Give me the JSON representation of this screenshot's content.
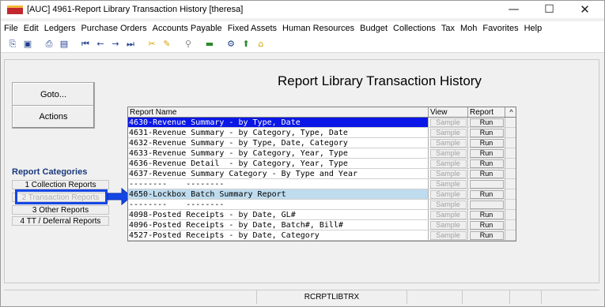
{
  "window": {
    "title": "[AUC] 4961-Report Library Transaction History [theresa]",
    "min_glyph": "—",
    "max_glyph": "☐",
    "close_glyph": "✕"
  },
  "menu": [
    "File",
    "Edit",
    "Ledgers",
    "Purchase Orders",
    "Accounts Payable",
    "Fixed Assets",
    "Human Resources",
    "Budget",
    "Collections",
    "Tax",
    "Moh",
    "Favorites",
    "Help"
  ],
  "toolbar": [
    "copy-icon",
    "paste-icon",
    "print-icon",
    "print-preview-icon",
    "first-record-icon",
    "previous-record-icon",
    "next-record-icon",
    "last-record-icon",
    "tools-icon",
    "tools2-icon",
    "find-icon",
    "view-icon",
    "settings-icon",
    "export-icon",
    "import-icon"
  ],
  "page": {
    "title": "Report Library Transaction History",
    "goto_label": "Goto...",
    "actions_label": "Actions"
  },
  "categories": {
    "title": "Report Categories",
    "items": [
      "1 Collection Reports",
      "2 Transaction Reports",
      "3 Other Reports",
      "4 TT / Deferral Reports"
    ]
  },
  "grid": {
    "headers": {
      "name": "Report Name",
      "view": "View",
      "report": "Report"
    },
    "sample_label": "Sample",
    "run_label": "Run",
    "rows": [
      {
        "name": "4630-Revenue Summary - by Type, Date",
        "run": true,
        "state": "selected"
      },
      {
        "name": "4631-Revenue Summary - by Category, Type, Date",
        "run": true,
        "state": ""
      },
      {
        "name": "4632-Revenue Summary - by Type, Date, Category",
        "run": true,
        "state": ""
      },
      {
        "name": "4633-Revenue Summary - by Category, Year, Type",
        "run": true,
        "state": ""
      },
      {
        "name": "4636-Revenue Detail  - by Category, Year, Type",
        "run": true,
        "state": ""
      },
      {
        "name": "4637-Revenue Summary Category - By Type and Year",
        "run": true,
        "state": ""
      },
      {
        "name": "--------    --------",
        "run": false,
        "state": ""
      },
      {
        "name": "4650-Lockbox Batch Summary Report",
        "run": true,
        "state": "lightsel"
      },
      {
        "name": "--------    --------",
        "run": false,
        "state": ""
      },
      {
        "name": "4098-Posted Receipts - by Date, GL#",
        "run": true,
        "state": ""
      },
      {
        "name": "4096-Posted Receipts - by Date, Batch#, Bill#",
        "run": true,
        "state": ""
      },
      {
        "name": "4527-Posted Receipts - by Date, Category",
        "run": true,
        "state": ""
      }
    ]
  },
  "status": {
    "program": "RCRPTLIBTRX"
  },
  "colors": {
    "selected_row": "#0a17e6",
    "highlight_box": "#1446e6",
    "light_selection": "#bfdcef"
  }
}
